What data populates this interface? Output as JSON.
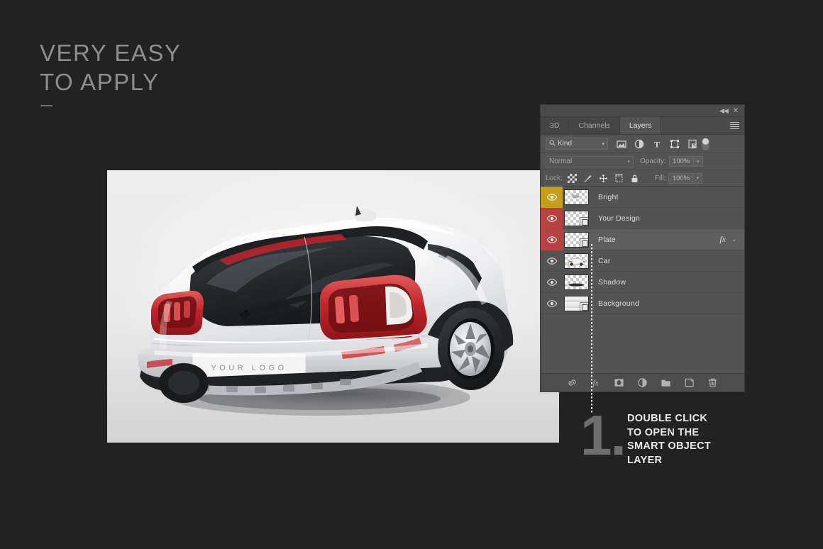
{
  "page": {
    "background_color": "#222222",
    "headline_line1": "VERY EASY",
    "headline_line2": "TO APPLY"
  },
  "photo": {
    "license_plate_text": "YOUR LOGO",
    "subject": "white-crossover-suv-rear-view"
  },
  "panel": {
    "titlebar": {
      "collapse_icon": "double-chevron-left",
      "close_icon": "close-x"
    },
    "tabs": [
      {
        "label": "3D",
        "active": false
      },
      {
        "label": "Channels",
        "active": false
      },
      {
        "label": "Layers",
        "active": true
      }
    ],
    "menu_icon": "panel-menu-hamburger",
    "filter_bar": {
      "kind_label": "Kind",
      "search_icon": "magnifier-icon",
      "chevron": "▾",
      "icons": [
        "filter-pixel-icon",
        "filter-adjustment-icon",
        "filter-type-icon",
        "filter-shape-icon",
        "filter-smart-object-icon"
      ],
      "toggle": "filter-enable-toggle"
    },
    "blend_row": {
      "mode": "Normal",
      "opacity_label": "Opacity:",
      "opacity_value": "100%"
    },
    "lock_row": {
      "lock_label": "Lock:",
      "icons": [
        "lock-transparency-icon",
        "lock-image-icon",
        "lock-position-icon",
        "lock-artboard-icon",
        "lock-all-icon"
      ],
      "fill_label": "Fill:",
      "fill_value": "100%"
    },
    "layers": [
      {
        "name": "Bright",
        "eye_color": "#c2a01c",
        "visible": true,
        "selected": false,
        "smart_object": false,
        "has_fx": false,
        "thumb": "checker-sparkle"
      },
      {
        "name": "Your Design",
        "eye_color": "#b84141",
        "visible": true,
        "selected": false,
        "smart_object": true,
        "has_fx": false,
        "thumb": "checker-empty"
      },
      {
        "name": "Plate",
        "eye_color": "#b84141",
        "visible": true,
        "selected": true,
        "smart_object": true,
        "has_fx": true,
        "thumb": "checker-empty"
      },
      {
        "name": "Car",
        "eye_color": "#535353",
        "visible": true,
        "selected": false,
        "smart_object": false,
        "has_fx": false,
        "thumb": "checker-car"
      },
      {
        "name": "Shadow",
        "eye_color": "#535353",
        "visible": true,
        "selected": false,
        "smart_object": false,
        "has_fx": false,
        "thumb": "checker-shadow"
      },
      {
        "name": "Background",
        "eye_color": "#535353",
        "visible": true,
        "selected": false,
        "smart_object": true,
        "has_fx": false,
        "thumb": "solid-gradient"
      }
    ],
    "fx_mark": "fx",
    "fx_chevron": "⌄",
    "bottom_bar_icons": [
      "link-layers-icon",
      "layer-style-fx-icon",
      "add-layer-mask-icon",
      "new-adjustment-layer-icon",
      "new-group-icon",
      "new-layer-icon",
      "delete-layer-icon"
    ]
  },
  "callout": {
    "number": "1.",
    "line1": "DOUBLE CLICK",
    "line2": "TO OPEN THE",
    "line3": "SMART OBJECT",
    "line4": "LAYER"
  }
}
